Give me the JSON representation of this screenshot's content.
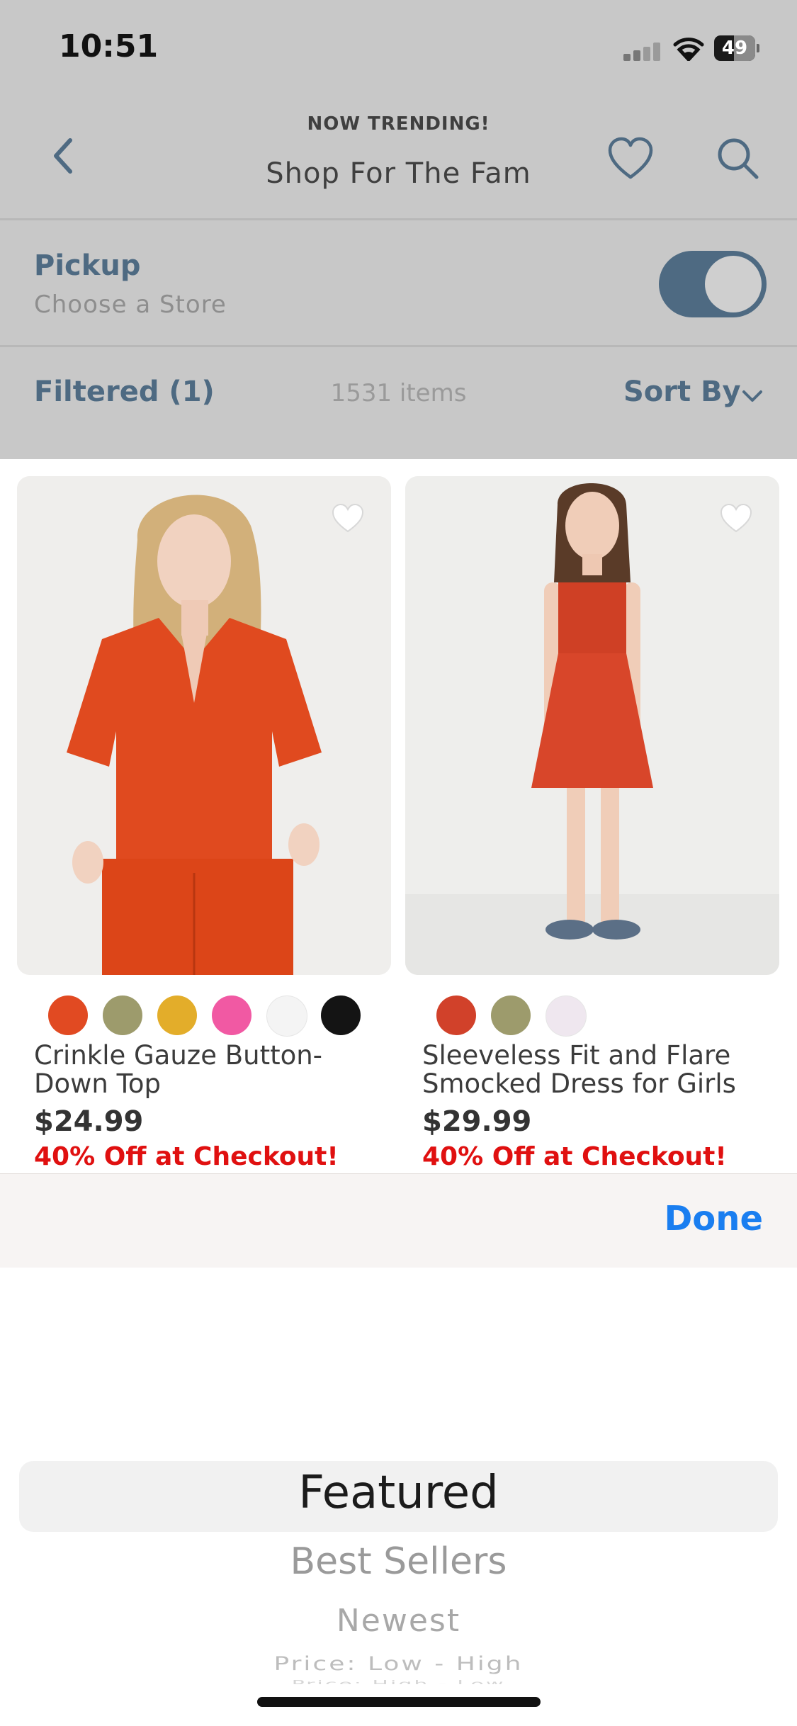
{
  "status_bar": {
    "time": "10:51",
    "battery": "49"
  },
  "nav": {
    "kicker": "NOW TRENDING!",
    "title": "Shop For The Fam"
  },
  "pickup": {
    "label": "Pickup",
    "sublabel": "Choose a Store",
    "toggle_on": true
  },
  "filter_bar": {
    "filtered_label": "Filtered (1)",
    "items_count": "1531 items",
    "sort_label": "Sort By"
  },
  "products": [
    {
      "name_line1": "Crinkle Gauze Button-",
      "name_line2": "Down Top",
      "price": "$24.99",
      "promo": "40% Off at Checkout!",
      "swatches": [
        "#e14a22",
        "#9d9b6c",
        "#e3ad2a",
        "#f159a3",
        "#f4f4f4",
        "#141414"
      ]
    },
    {
      "name_line1": "Sleeveless Fit and Flare",
      "name_line2": "Smocked Dress for Girls",
      "price": "$29.99",
      "promo": "40% Off at Checkout!",
      "swatches": [
        "#d1412a",
        "#9d9b6c",
        "#efe7ef"
      ]
    }
  ],
  "picker": {
    "done_label": "Done",
    "options": [
      "Featured",
      "Best Sellers",
      "Newest",
      "Price: Low - High",
      "Price: High - Low"
    ],
    "selected": "Featured"
  },
  "colors": {
    "accent": "#4e6a82",
    "promo": "#e01010",
    "done": "#1a7ef0"
  }
}
